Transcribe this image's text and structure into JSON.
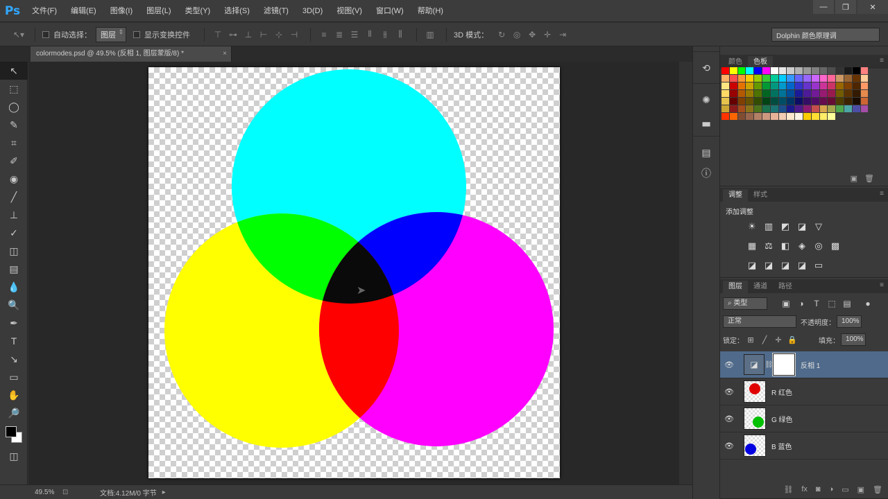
{
  "app": {
    "logo": "Ps"
  },
  "menu": [
    "文件(F)",
    "编辑(E)",
    "图像(I)",
    "图层(L)",
    "类型(Y)",
    "选择(S)",
    "滤镜(T)",
    "3D(D)",
    "视图(V)",
    "窗口(W)",
    "帮助(H)"
  ],
  "window_controls": {
    "minimize": "—",
    "restore": "❐",
    "close": "✕"
  },
  "options": {
    "auto_select_label": "自动选择：",
    "auto_select_value": "图层",
    "show_transform_label": "显示变换控件",
    "mode_3d_label": "3D 模式：",
    "workspace": "Dolphin 颜色原理调"
  },
  "document": {
    "tab_title": "colormodes.psd @ 49.5% (反相 1, 图层蒙版/8) *",
    "tab_close": "×"
  },
  "tools": [
    "↖",
    "⬚",
    "◯",
    "✎",
    "⌗",
    "✐",
    "◉",
    "╱",
    "⊥",
    "✓",
    "◫",
    "▤",
    "💧",
    "🔍",
    "✒",
    "T",
    "↘",
    "▭",
    "✋",
    "🔎"
  ],
  "status": {
    "zoom": "49.5%",
    "doc_info": "文档:4.12M/0 字节",
    "arrow": "▸"
  },
  "panels": {
    "swatch_tabs": [
      "颜色",
      "色板"
    ],
    "adjust_tabs": [
      "调整",
      "样式"
    ],
    "adjust_label": "添加调整",
    "layers_tabs": [
      "图层",
      "通道",
      "路径"
    ],
    "filter_kind": "类型",
    "blend_mode": "正常",
    "opacity_label": "不透明度：",
    "opacity_value": "100%",
    "lock_label": "锁定：",
    "fill_label": "填充：",
    "fill_value": "100%",
    "menu_icon": "≡"
  },
  "layers": [
    {
      "name": "反相 1",
      "kind": "adjustment",
      "selected": true
    },
    {
      "name": "R 红色",
      "kind": "pixel",
      "color": "#e00000",
      "selected": false
    },
    {
      "name": "G 绿色",
      "kind": "pixel",
      "color": "#00c000",
      "selected": false
    },
    {
      "name": "B 蓝色",
      "kind": "pixel",
      "color": "#0000e0",
      "selected": false
    }
  ],
  "colors": {
    "cyan": "#00ffff",
    "magenta": "#ff00ff",
    "yellow": "#ffff00",
    "green": "#00ff00",
    "blue": "#0000ff",
    "red": "#ff0000",
    "black": "#0a0a0a"
  },
  "swatches": [
    "#ff0000",
    "#ffff00",
    "#00ff00",
    "#00ffff",
    "#0000ff",
    "#ff00ff",
    "#ffffff",
    "#e6e6e6",
    "#cccccc",
    "#b3b3b3",
    "#999999",
    "#808080",
    "#666666",
    "#4d4d4d",
    "#333333",
    "#1a1a1a",
    "#000000",
    "#ff8080",
    "#ffb366",
    "#ff4d4d",
    "#ff9933",
    "#ffcc00",
    "#99cc00",
    "#33cc33",
    "#00cc99",
    "#00ccff",
    "#3399ff",
    "#6666ff",
    "#9966ff",
    "#cc66ff",
    "#ff66cc",
    "#ff6699",
    "#cc9966",
    "#996633",
    "#663300",
    "#ffcc99",
    "#ffe680",
    "#cc0000",
    "#e67300",
    "#cca300",
    "#669900",
    "#009933",
    "#009980",
    "#0099cc",
    "#0066cc",
    "#3333cc",
    "#6633cc",
    "#9933cc",
    "#cc3399",
    "#cc3366",
    "#996600",
    "#804000",
    "#4d2600",
    "#ff9966",
    "#ffd966",
    "#990000",
    "#b35900",
    "#997a00",
    "#4d7300",
    "#006622",
    "#007360",
    "#007399",
    "#004d99",
    "#1a1a99",
    "#4d1a99",
    "#731a99",
    "#991a73",
    "#991a4d",
    "#735c00",
    "#5c3300",
    "#331a00",
    "#e68a4d",
    "#e6c34d",
    "#660000",
    "#804000",
    "#665200",
    "#334d00",
    "#004416",
    "#004d40",
    "#004d66",
    "#003366",
    "#0d0d66",
    "#330d66",
    "#4d0d66",
    "#660d4d",
    "#660d33",
    "#4d3d00",
    "#3d2200",
    "#1a0d00",
    "#cc6633",
    "#cca633",
    "#8c1a1a",
    "#a64d1a",
    "#8c731a",
    "#4d731a",
    "#1a734d",
    "#1a7373",
    "#1a4d8c",
    "#1a1a8c",
    "#4d1a8c",
    "#8c1a73",
    "#c44d4d",
    "#d9a64d",
    "#a6a64d",
    "#4da64d",
    "#4da6a6",
    "#4d4da6",
    "#a64da6",
    "#ff3300",
    "#ff6600",
    "#804d33",
    "#99664d",
    "#b38066",
    "#cc9980",
    "#e6b399",
    "#f2ccb3",
    "#ffe6cc",
    "#fff2e6",
    "#ffcc00",
    "#ffdd33",
    "#ffee66",
    "#ffff99"
  ],
  "adjust_rows": [
    [
      "☀",
      "▥",
      "◩",
      "◪",
      "▽"
    ],
    [
      "▦",
      "⚖",
      "◧",
      "◈",
      "◎",
      "▩"
    ],
    [
      "◪",
      "◪",
      "◪",
      "◪",
      "▭"
    ]
  ]
}
